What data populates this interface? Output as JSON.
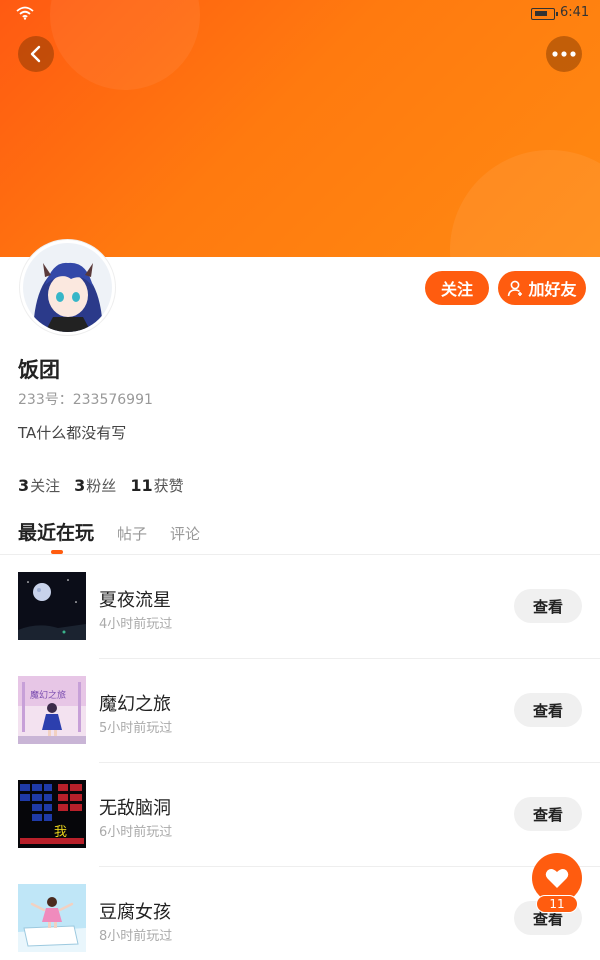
{
  "status_bar": {
    "time": "6:41",
    "wifi_icon": "wifi-icon",
    "battery_icon": "battery-icon"
  },
  "colors": {
    "accent": "#ff5c0f",
    "banner": "#ff7a0f"
  },
  "header": {
    "back_icon": "chevron-left-icon",
    "more_icon": "more-dots-icon"
  },
  "profile": {
    "name": "饭团",
    "uid": "233号：233576991",
    "bio": "TA什么都没有写",
    "follow_label": "关注",
    "add_friend_label": "加好友",
    "stats": [
      {
        "count": "3",
        "label": "关注"
      },
      {
        "count": "3",
        "label": "粉丝"
      },
      {
        "count": "11",
        "label": "获赞"
      }
    ]
  },
  "tabs": [
    {
      "label": "最近在玩",
      "active": true
    },
    {
      "label": "帖子",
      "active": false
    },
    {
      "label": "评论",
      "active": false
    }
  ],
  "games": [
    {
      "title": "夏夜流星",
      "played": "4小时前玩过",
      "action": "查看"
    },
    {
      "title": "魔幻之旅",
      "played": "5小时前玩过",
      "action": "查看",
      "thumb_text": "魔幻之旅"
    },
    {
      "title": "无敌脑洞",
      "played": "6小时前玩过",
      "action": "查看",
      "thumb_text": "我"
    },
    {
      "title": "豆腐女孩",
      "played": "8小时前玩过",
      "action": "查看"
    }
  ],
  "fab": {
    "icon": "heart-icon",
    "count": "11"
  }
}
